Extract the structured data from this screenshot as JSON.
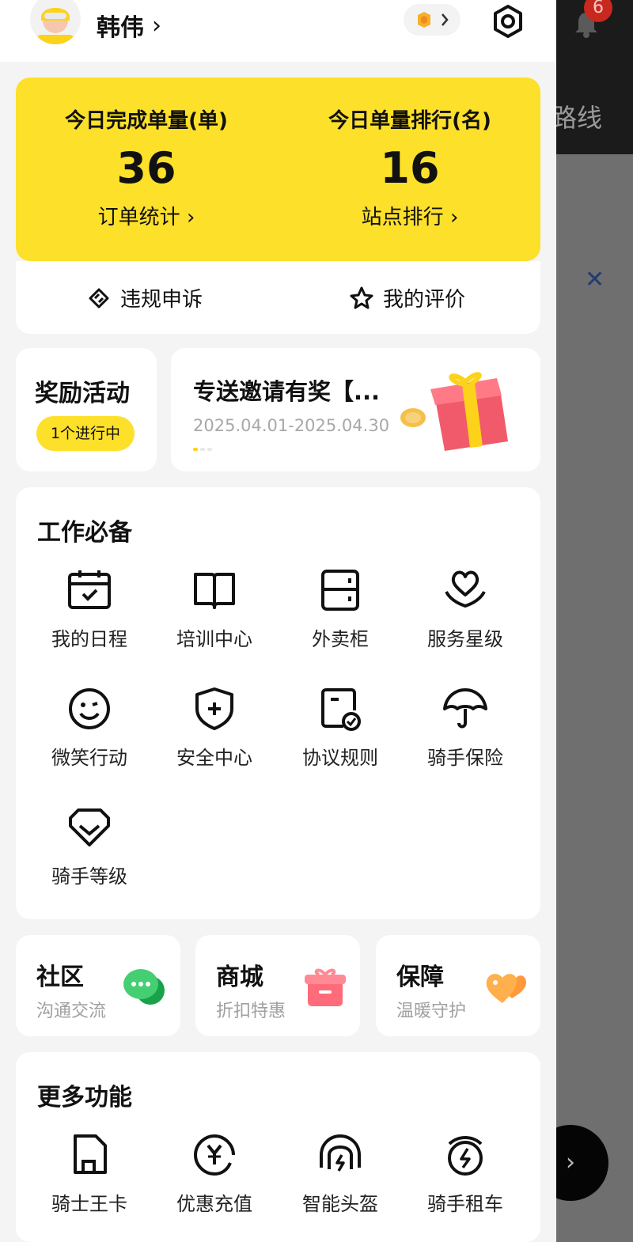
{
  "header": {
    "username": "韩伟",
    "chevron": "›"
  },
  "stats": {
    "completed_label": "今日完成单量(单)",
    "completed_value": "36",
    "completed_link": "订单统计",
    "rank_label": "今日单量排行(名)",
    "rank_value": "16",
    "rank_link": "站点排行",
    "link_chevron": "›"
  },
  "sub_actions": {
    "appeal": "违规申诉",
    "rating": "我的评价"
  },
  "reward": {
    "title": "奖励活动",
    "badge": "1个进行中"
  },
  "promo": {
    "title": "专送邀请有奖【...",
    "date": "2025.04.01-2025.04.30"
  },
  "work_essentials": {
    "title": "工作必备",
    "items": [
      {
        "label": "我的日程",
        "icon": "calendar-icon"
      },
      {
        "label": "培训中心",
        "icon": "book-icon"
      },
      {
        "label": "外卖柜",
        "icon": "locker-icon"
      },
      {
        "label": "服务星级",
        "icon": "heart-hand-icon"
      },
      {
        "label": "微笑行动",
        "icon": "smile-icon"
      },
      {
        "label": "安全中心",
        "icon": "shield-icon"
      },
      {
        "label": "协议规则",
        "icon": "document-check-icon"
      },
      {
        "label": "骑手保险",
        "icon": "umbrella-icon"
      },
      {
        "label": "骑手等级",
        "icon": "badge-icon"
      }
    ]
  },
  "mini_cards": [
    {
      "title": "社区",
      "subtitle": "沟通交流",
      "icon": "chat-icon"
    },
    {
      "title": "商城",
      "subtitle": "折扣特惠",
      "icon": "gift-box-icon"
    },
    {
      "title": "保障",
      "subtitle": "温暖守护",
      "icon": "heart-icon"
    }
  ],
  "more_features": {
    "title": "更多功能",
    "items": [
      {
        "label": "骑士王卡",
        "icon": "sim-card-icon"
      },
      {
        "label": "优惠充值",
        "icon": "yen-icon"
      },
      {
        "label": "智能头盔",
        "icon": "helmet-icon"
      },
      {
        "label": "骑手租车",
        "icon": "battery-swap-icon"
      }
    ]
  },
  "background": {
    "text": "路线",
    "notification_count": "6",
    "close": "✕",
    "chevron": "›"
  },
  "colors": {
    "accent_yellow": "#fde02a",
    "badge_red": "#c8281e"
  }
}
